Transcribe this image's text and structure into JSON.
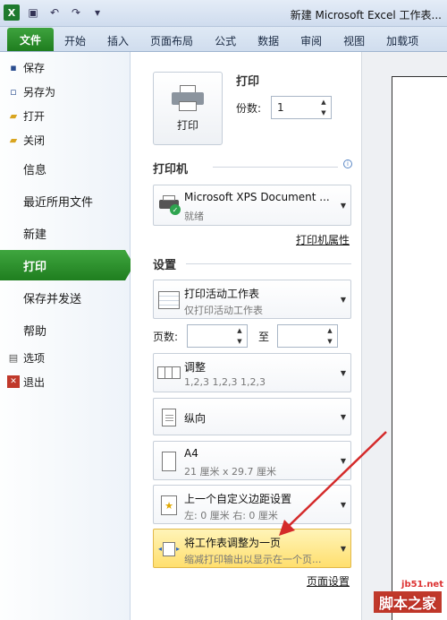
{
  "window": {
    "title": "新建 Microsoft Excel 工作表..."
  },
  "tabs": [
    "文件",
    "开始",
    "插入",
    "页面布局",
    "公式",
    "数据",
    "审阅",
    "视图",
    "加载项"
  ],
  "nav": {
    "save": "保存",
    "save_as": "另存为",
    "open": "打开",
    "close": "关闭",
    "info": "信息",
    "recent": "最近所用文件",
    "new": "新建",
    "print": "打印",
    "save_send": "保存并发送",
    "help": "帮助",
    "options": "选项",
    "exit": "退出"
  },
  "print": {
    "heading": "打印",
    "button_label": "打印",
    "copies_label": "份数:",
    "copies_value": "1"
  },
  "printer": {
    "heading": "打印机",
    "name": "Microsoft XPS Document ...",
    "status": "就绪",
    "properties_link": "打印机属性"
  },
  "settings": {
    "heading": "设置",
    "scope": {
      "title": "打印活动工作表",
      "subtitle": "仅打印活动工作表"
    },
    "pages_label": "页数:",
    "to_label": "至",
    "collate": {
      "title": "调整",
      "subtitle": "1,2,3    1,2,3    1,2,3"
    },
    "orientation": {
      "title": "纵向"
    },
    "paper": {
      "title": "A4",
      "subtitle": "21 厘米 x 29.7 厘米"
    },
    "margins": {
      "title": "上一个自定义边距设置",
      "subtitle": "左: 0 厘米    右: 0 厘米"
    },
    "scaling": {
      "title": "将工作表调整为一页",
      "subtitle": "缩减打印输出以显示在一个页..."
    },
    "page_setup_link": "页面设置"
  },
  "watermark": {
    "site": "jb51.net",
    "name": "脚本之家"
  },
  "colors": {
    "accent_green": "#2e8f2e",
    "highlight": "#ffdf6e",
    "arrow": "#d42a2a"
  },
  "icons": [
    "excel-logo-icon",
    "save-icon",
    "undo-icon",
    "redo-icon",
    "printer-icon",
    "info-icon",
    "check-icon",
    "doc-icon",
    "caret-down-icon"
  ]
}
